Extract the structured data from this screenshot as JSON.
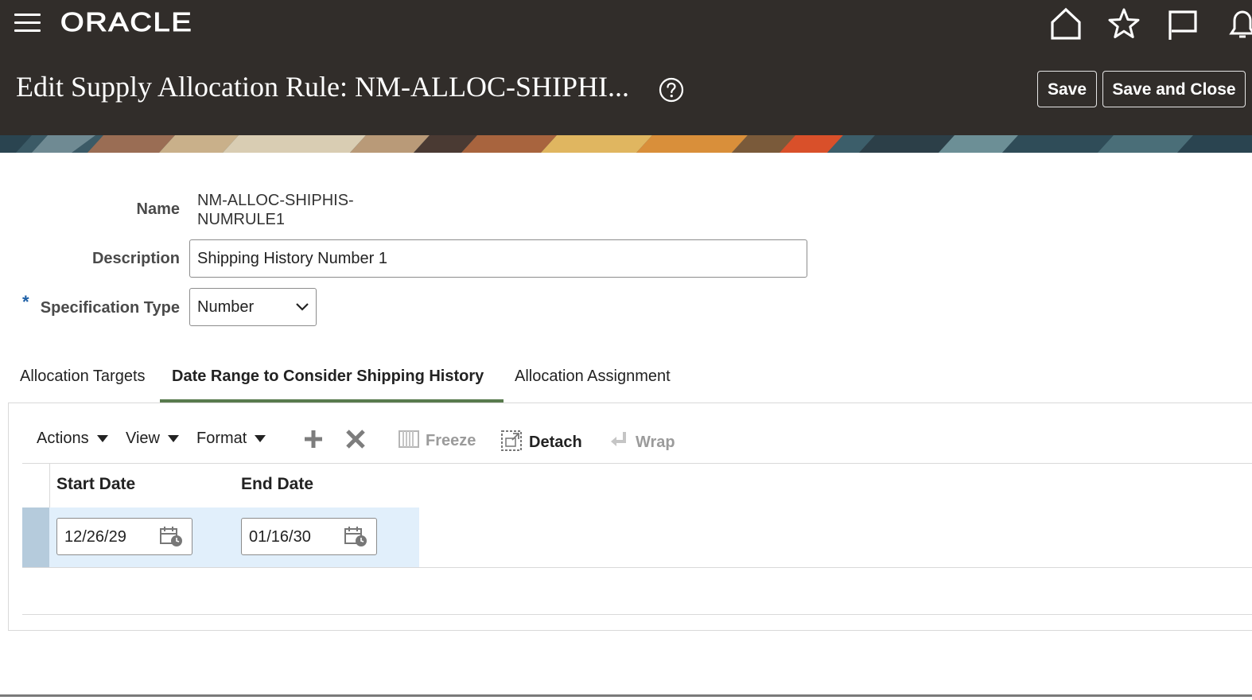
{
  "header": {
    "logo": "ORACLE",
    "title": "Edit Supply Allocation Rule: NM-ALLOC-SHIPHI...",
    "save_label": "Save",
    "save_close_label": "Save and Close",
    "icons": [
      "menu-icon",
      "home-icon",
      "star-icon",
      "flag-icon",
      "bell-icon",
      "help-icon"
    ]
  },
  "form": {
    "name_label": "Name",
    "name_value_line1": "NM-ALLOC-SHIPHIS-",
    "name_value_line2": "NUMRULE1",
    "description_label": "Description",
    "description_value": "Shipping History Number 1",
    "spec_type_required_marker": "*",
    "spec_type_label": "Specification Type",
    "spec_type_value": "Number"
  },
  "tabs": [
    {
      "label": "Allocation Targets",
      "active": false
    },
    {
      "label": "Date Range to Consider Shipping History",
      "active": true
    },
    {
      "label": "Allocation Assignment",
      "active": false
    }
  ],
  "toolbar": {
    "actions": "Actions",
    "view": "View",
    "format": "Format",
    "freeze": "Freeze",
    "detach": "Detach",
    "wrap": "Wrap"
  },
  "table": {
    "columns": [
      "Start Date",
      "End Date"
    ],
    "rows": [
      {
        "start_date": "12/26/29",
        "end_date": "01/16/30"
      }
    ]
  },
  "colors": {
    "header_bg": "#312d2a",
    "active_tab_underline": "#587a4d",
    "selected_row_bg": "#e1effb",
    "row_selector": "#b5cbdc",
    "required_marker": "#1c5fa6"
  }
}
